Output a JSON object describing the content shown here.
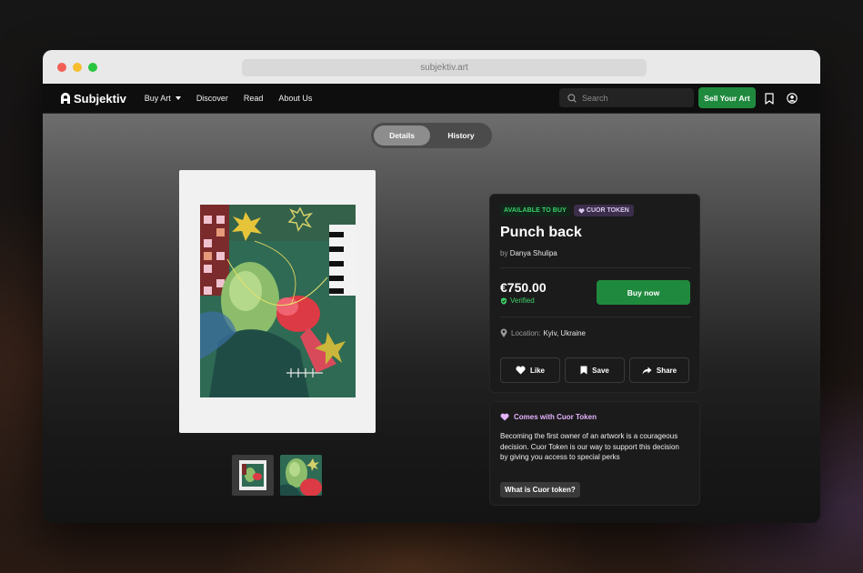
{
  "browser": {
    "url": "subjektiv.art"
  },
  "nav": {
    "logo": "Subjektiv",
    "links": [
      "Buy Art",
      "Discover",
      "Read",
      "About Us"
    ],
    "search_placeholder": "Search",
    "sell_label": "Sell Your Art"
  },
  "tabs": {
    "details": "Details",
    "history": "History"
  },
  "artwork": {
    "badge_available": "AVAILABLE TO BUY",
    "badge_token": "CUOR TOKEN",
    "title": "Punch back",
    "by_prefix": "by",
    "artist": "Danya Shulipa",
    "price": "€750.00",
    "verified": "Verified",
    "buy_label": "Buy now",
    "location_label": "Location:",
    "location_value": "Kyiv, Ukraine",
    "actions": {
      "like": "Like",
      "save": "Save",
      "share": "Share"
    }
  },
  "token": {
    "heading": "Comes with Cuor Token",
    "body": "Becoming the first owner of an artwork is a courageous decision. Cuor Token is our way to support this decision by giving you access to special perks",
    "link": "What is Cuor token?"
  },
  "colors": {
    "accent_green": "#1f8a3e",
    "verified_green": "#3dd06a",
    "token_purple": "#e4b3ff"
  }
}
